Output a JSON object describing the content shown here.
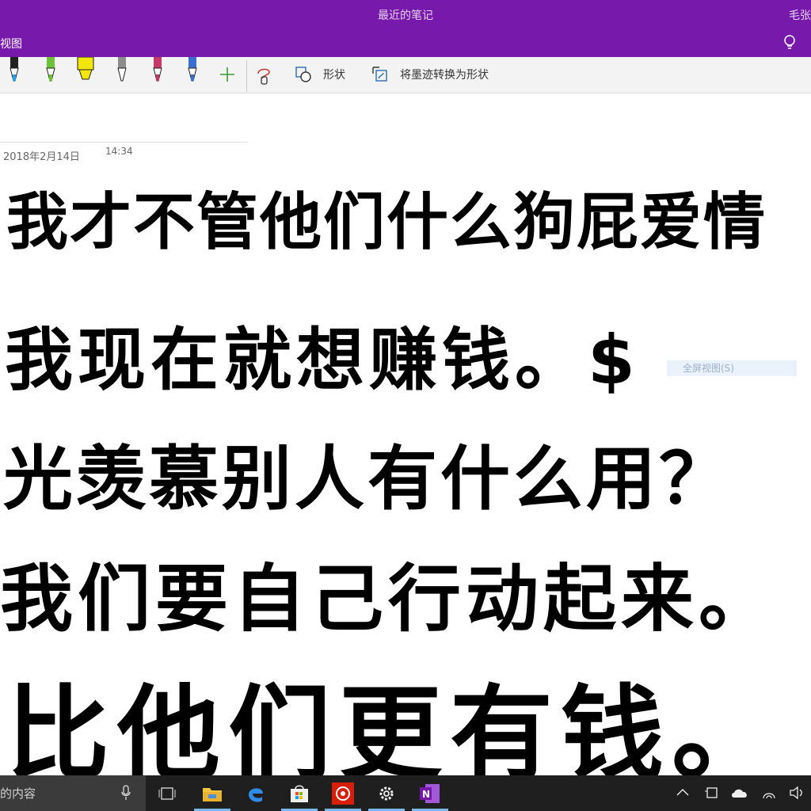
{
  "window": {
    "title": "最近的笔记",
    "user_partial": "毛张"
  },
  "ribbon": {
    "visible_tab_partial": "视图",
    "tell_me_icon": "lightbulb-icon"
  },
  "toolbar": {
    "pens": [
      {
        "name": "pen-blue",
        "color": "#2d9be0"
      },
      {
        "name": "pen-green",
        "color": "#6cc33a"
      },
      {
        "name": "highlighter-yellow",
        "color": "#f2e60a"
      },
      {
        "name": "pencil-gray",
        "color": "#8c8c8c"
      },
      {
        "name": "pen-galaxy",
        "color": "#c43b6a"
      },
      {
        "name": "pen-ocean",
        "color": "#3a6fd0"
      }
    ],
    "add_pen_icon": "plus-icon",
    "lasso_icon": "lasso-select-icon",
    "shapes_label": "形状",
    "ink_to_shape_label": "将墨迹转换为形状"
  },
  "page": {
    "date": "2018年2月14日",
    "time": "14:34",
    "handwriting_lines": [
      "我才不管他们什么狗屁爱情",
      "我现在就想赚钱。$",
      "光羡慕别人有什么用？",
      "我们要自己行动起来。",
      "比他们更有钱。"
    ],
    "faded_tooltip": "全屏视图(S)"
  },
  "taskbar": {
    "search_partial": "的内容",
    "apps": [
      {
        "name": "task-view-icon"
      },
      {
        "name": "file-explorer-icon"
      },
      {
        "name": "edge-icon"
      },
      {
        "name": "store-icon"
      },
      {
        "name": "netease-music-icon"
      },
      {
        "name": "settings-icon"
      },
      {
        "name": "onenote-icon"
      }
    ],
    "tray": [
      "chevron-up-icon",
      "tablet-icon",
      "onedrive-icon",
      "wifi-icon",
      "volume-icon"
    ]
  },
  "colors": {
    "onenote_purple": "#7719aa",
    "ink": "#000000"
  }
}
